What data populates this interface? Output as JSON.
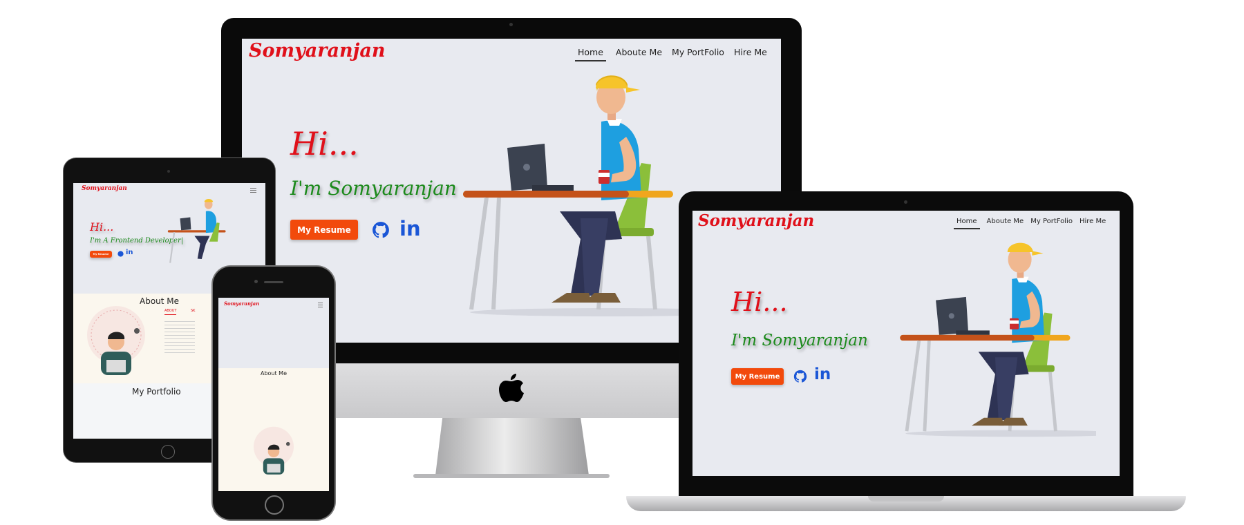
{
  "site": {
    "brand": "Somyaranjan",
    "nav": [
      "Home",
      "Aboute Me",
      "My PortFolio",
      "Hire Me"
    ],
    "greeting": "Hi...",
    "intro": "I'm Somyaranjan",
    "intro_tablet": "I'm A Frontend Developer|",
    "resume_label": "My Resume",
    "social": [
      "github-icon",
      "linkedin-icon"
    ],
    "linkedin_text": "in",
    "about_title": "About Me",
    "about_tabs": [
      "ABOUT",
      "SK"
    ],
    "portfolio_title": "My Portfolio"
  },
  "colors": {
    "brand": "#e0101a",
    "intro": "#1b8a1b",
    "button": "#f24a0c",
    "social": "#1a56d6",
    "screen_bg": "#e8eaf0",
    "about_bg": "#fbf7ee"
  }
}
